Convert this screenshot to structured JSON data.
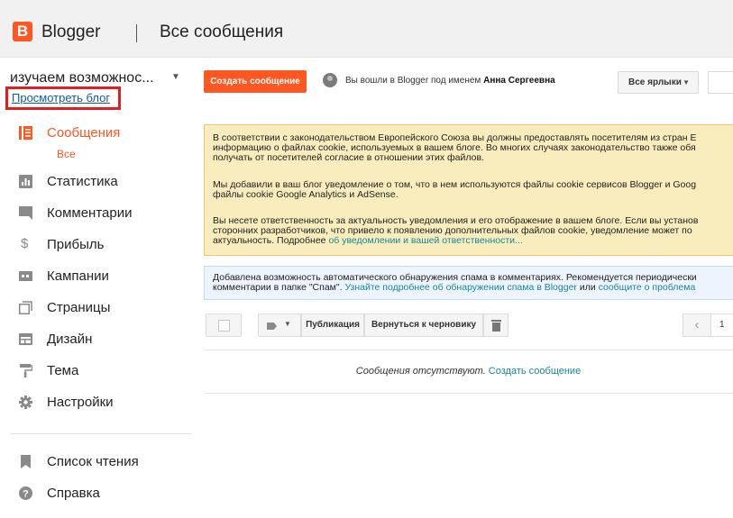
{
  "header": {
    "logo_letter": "B",
    "brand": "Blogger",
    "page_title": "Все сообщения",
    "brand_color": "#ff5722"
  },
  "sidebar": {
    "blog_name": "изучаем возможнос...",
    "view_blog": "Просмотреть блог",
    "items": [
      {
        "label": "Сообщения",
        "icon": "posts-icon",
        "active": true
      },
      {
        "label": "Статистика",
        "icon": "stats-icon"
      },
      {
        "label": "Комментарии",
        "icon": "comments-icon"
      },
      {
        "label": "Прибыль",
        "icon": "dollar-icon"
      },
      {
        "label": "Кампании",
        "icon": "campaigns-icon"
      },
      {
        "label": "Страницы",
        "icon": "pages-icon"
      },
      {
        "label": "Дизайн",
        "icon": "layout-icon"
      },
      {
        "label": "Тема",
        "icon": "paint-roller-icon"
      },
      {
        "label": "Настройки",
        "icon": "gear-icon"
      }
    ],
    "sub_item": "Все",
    "bottom_items": [
      {
        "label": "Список чтения",
        "icon": "bookmark-icon"
      },
      {
        "label": "Справка",
        "icon": "help-icon"
      }
    ]
  },
  "toolbar": {
    "create_label": "Создать сообщение",
    "signed_in_prefix": "Вы вошли в Blogger под именем",
    "user_name": "Анна Сергеевна",
    "labels_label": "Все ярлыки"
  },
  "notice_cookie": {
    "p1_line1": "В соответствии с законодательством Европейского Союза вы должны предоставлять посетителям из стран Е",
    "p1_line2": "информацию о файлах cookie, используемых в вашем блоге. Во многих случаях законодательство также обя",
    "p1_line3": "получать от посетителей согласие в отношении этих файлов.",
    "p2_line1": "Мы добавили в ваш блог уведомление о том, что в нем используются файлы cookie сервисов Blogger и Goog",
    "p2_line2": "файлы cookie Google Analytics и AdSense.",
    "p3_line1": "Вы несете ответственность за актуальность уведомления и его отображение в вашем блоге. Если вы установ",
    "p3_line2": "сторонних разработчиков, что привело к появлению дополнительных файлов cookie, уведомление может по",
    "p3_line3_text": "актуальность. Подробнее",
    "p3_link": "об уведомлении и вашей ответственности..."
  },
  "notice_spam": {
    "line1": "Добавлена возможность автоматического обнаружения спама в комментариях. Рекомендуется периодически",
    "line2_text": "комментарии в папке \"Спам\".",
    "link1": "Узнайте подробнее об обнаружении спама в Blogger",
    "mid_text": "или",
    "link2": "сообщите о проблема"
  },
  "posts_toolbar": {
    "publish": "Публикация",
    "revert": "Вернуться к черновику",
    "prev": "‹",
    "page": "1"
  },
  "empty": {
    "text": "Сообщения отсутствуют.",
    "link": "Создать сообщение"
  }
}
